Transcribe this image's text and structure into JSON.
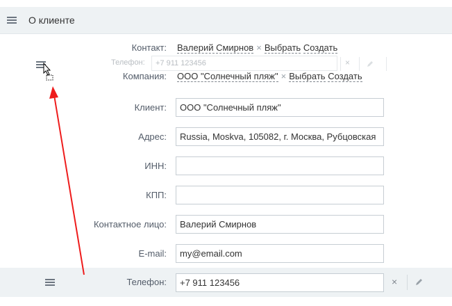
{
  "header": {
    "title": "О клиенте",
    "menu_icon": "hamburger-icon"
  },
  "contact": {
    "label": "Контакт:",
    "value": "Валерий Смирнов",
    "remove": "×",
    "select_label": "Выбрать",
    "create_label": "Создать"
  },
  "ghost_phone": {
    "label": "Телефон:",
    "value": "+7 911 123456"
  },
  "company": {
    "label": "Компания:",
    "value": "ООО \"Солнечный пляж\"",
    "remove": "×",
    "select_label": "Выбрать",
    "create_label": "Создать"
  },
  "fields": {
    "client": {
      "label": "Клиент:",
      "value": "ООО \"Солнечный пляж\""
    },
    "address": {
      "label": "Адрес:",
      "value": "Russia, Moskva, 105082, г. Москва, Рубцовская"
    },
    "inn": {
      "label": "ИНН:",
      "value": ""
    },
    "kpp": {
      "label": "КПП:",
      "value": ""
    },
    "contact_person": {
      "label": "Контактное лицо:",
      "value": "Валерий Смирнов"
    },
    "email": {
      "label": "E-mail:",
      "value": "my@email.com"
    },
    "phone": {
      "label": "Телефон:",
      "value": "+7 911 123456",
      "clear": "×"
    }
  },
  "colors": {
    "annotation_arrow": "#ee1c1c",
    "row_highlight": "#eef2f4"
  }
}
